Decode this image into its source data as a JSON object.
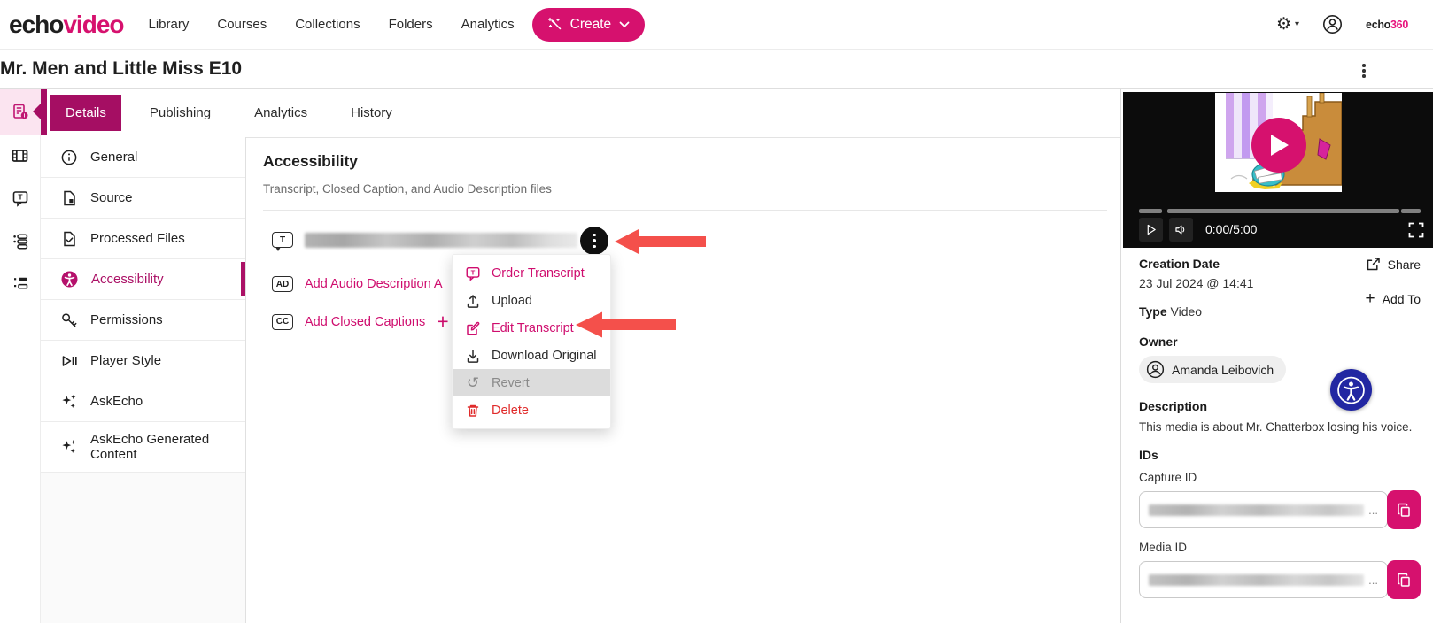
{
  "nav": {
    "logo": {
      "part1": "echo",
      "part2": "video"
    },
    "links": [
      "Library",
      "Courses",
      "Collections",
      "Folders",
      "Analytics"
    ],
    "create_label": "Create",
    "brand_small": {
      "part1": "echo",
      "part2": "360"
    }
  },
  "header": {
    "title": "Mr. Men and Little Miss E10"
  },
  "tabs": [
    "Details",
    "Publishing",
    "Analytics",
    "History"
  ],
  "side_menu": [
    "General",
    "Source",
    "Processed Files",
    "Accessibility",
    "Permissions",
    "Player Style",
    "AskEcho",
    "AskEcho Generated Content"
  ],
  "content": {
    "heading": "Accessibility",
    "subtitle": "Transcript, Closed Caption, and Audio Description files",
    "badges": {
      "transcript": "T",
      "audio_description": "AD",
      "closed_captions": "CC"
    },
    "add_audio_description": "Add Audio Description A",
    "add_closed_captions": "Add Closed Captions",
    "plus": "+"
  },
  "context_menu": {
    "items": [
      {
        "label": "Order Transcript"
      },
      {
        "label": "Upload"
      },
      {
        "label": "Edit Transcript"
      },
      {
        "label": "Download Original"
      },
      {
        "label": "Revert"
      },
      {
        "label": "Delete"
      }
    ]
  },
  "player": {
    "time": "0:00/5:00"
  },
  "details_panel": {
    "creation_date_label": "Creation Date",
    "creation_date": "23 Jul 2024 @ 14:41",
    "share_label": "Share",
    "type_label": "Type",
    "type_value": "Video",
    "add_to_label": "Add To",
    "owner_label": "Owner",
    "owner_name": "Amanda Leibovich",
    "description_label": "Description",
    "description": "This media is about Mr. Chatterbox losing his voice.",
    "ids_label": "IDs",
    "capture_id_label": "Capture ID",
    "media_id_label": "Media ID",
    "ellipsis": "..."
  },
  "colors": {
    "brand_pink": "#d6116e",
    "tab_pink": "#a50e63",
    "link_pink": "#cf0d6e",
    "arrow_red": "#f4504b",
    "danger_red": "#e02b2b",
    "a11y_blue": "#2227a2"
  }
}
